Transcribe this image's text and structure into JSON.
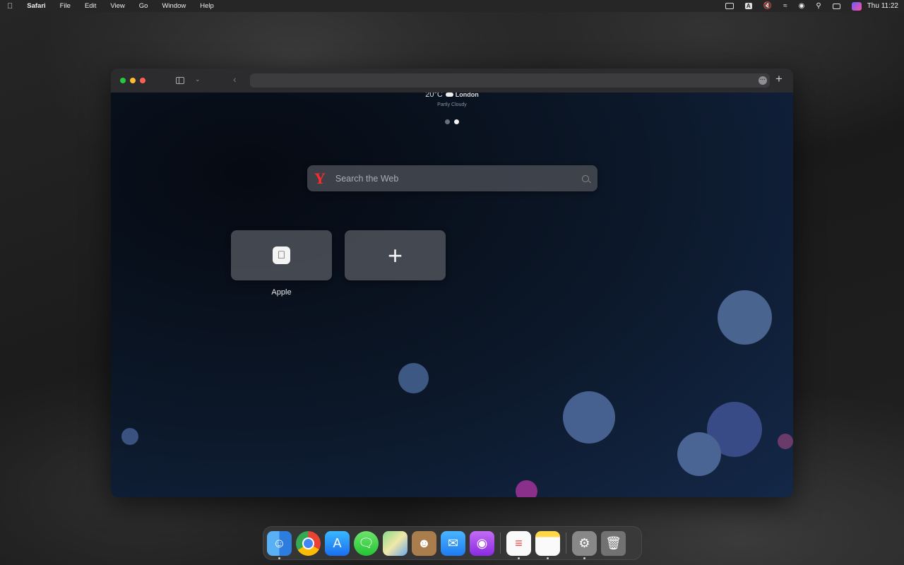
{
  "menubar": {
    "app_name": "Safari",
    "menus": [
      "File",
      "Edit",
      "View",
      "Go",
      "Window",
      "Help"
    ],
    "clock": "Thu 11:22",
    "input_indicator": "A"
  },
  "weather": {
    "temperature": "20°C",
    "city": "London",
    "condition": "Partly Cloudy"
  },
  "search": {
    "placeholder": "Search the Web"
  },
  "favorites": [
    {
      "label": "Apple"
    }
  ],
  "dock": {
    "apps": [
      "Finder",
      "Google Chrome",
      "App Store",
      "Messages",
      "Maps",
      "Contacts",
      "Mail",
      "Podcasts",
      "Reminders",
      "Notes",
      "System Settings",
      "Trash"
    ]
  },
  "colors": {
    "accent_yandex": "#ff2a2a",
    "traffic_red": "#ff5f57",
    "traffic_yellow": "#febc2e",
    "traffic_green": "#28c840"
  }
}
